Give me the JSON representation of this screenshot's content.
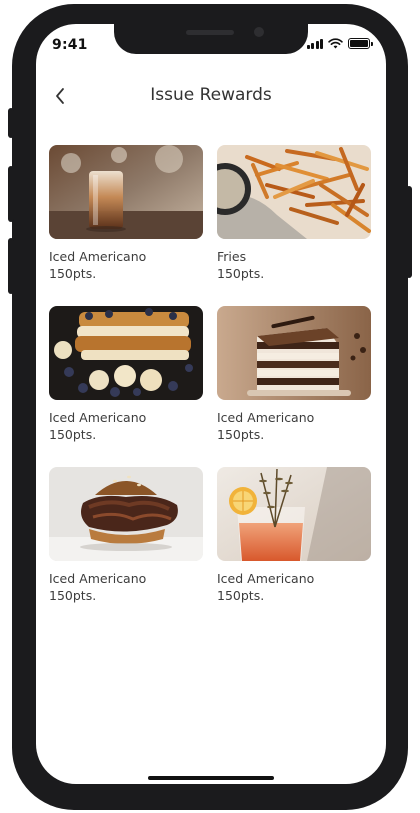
{
  "status_bar": {
    "time": "9:41"
  },
  "header": {
    "title": "Issue Rewards"
  },
  "rewards": [
    {
      "name": "Iced Americano",
      "points": "150pts.",
      "image": "iced-americano"
    },
    {
      "name": "Fries",
      "points": "150pts.",
      "image": "fries"
    },
    {
      "name": "Iced Americano",
      "points": "150pts.",
      "image": "french-toast"
    },
    {
      "name": "Iced Americano",
      "points": "150pts.",
      "image": "layer-cake"
    },
    {
      "name": "Iced Americano",
      "points": "150pts.",
      "image": "burger"
    },
    {
      "name": "Iced Americano",
      "points": "150pts.",
      "image": "cocktail"
    }
  ],
  "colors": {
    "frame": "#1b1b1d",
    "screen": "#ffffff",
    "text": "#3d3d3d"
  }
}
